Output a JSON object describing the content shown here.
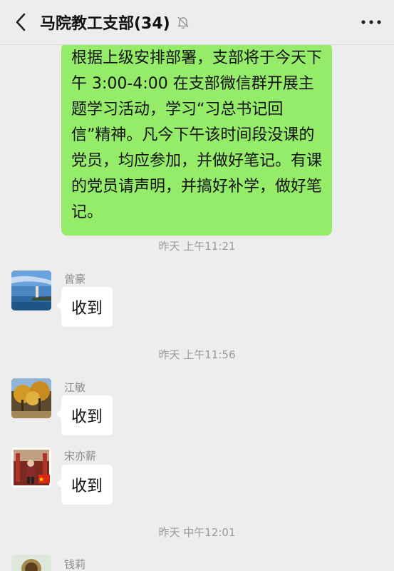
{
  "header": {
    "title": "马院教工支部(34)",
    "back_icon": "chevron-left-icon",
    "mute_icon": "bell-off-icon",
    "more_icon": "ellipsis-icon"
  },
  "messages": {
    "mine_text": "根据上级安排部署，支部将于今天下午 3:00-4:00 在支部微信群开展主题学习活动，学习“习总书记回信”精神。凡今下午该时间段没课的党员，均应参加，并做好笔记。有课的党员请声明，并搞好补学，做好笔记。",
    "time1": "昨天 上午11:21",
    "sender1": "曾豪",
    "text1": "收到",
    "time2": "昨天 上午11:56",
    "sender2": "江敏",
    "text2": "收到",
    "sender3": "宋亦薪",
    "text3": "收到",
    "time3": "昨天 中午12:01",
    "sender4": "钱莉"
  },
  "colors": {
    "my_bubble": "#95ec69",
    "background": "#ededed"
  }
}
